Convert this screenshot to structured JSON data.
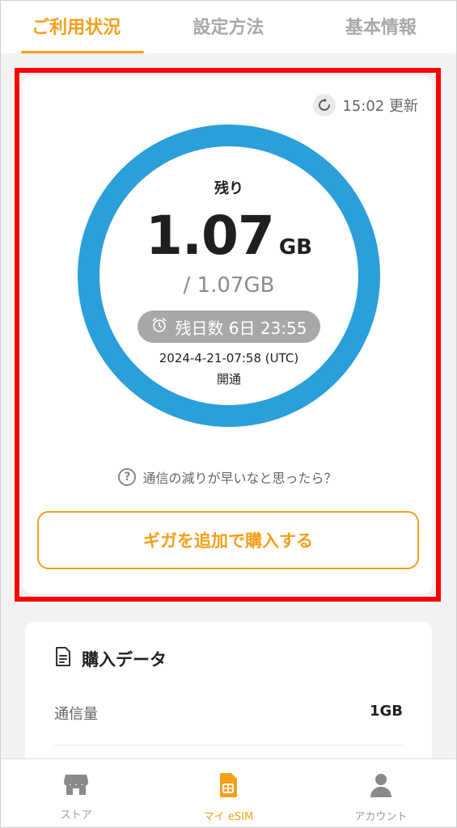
{
  "tabs": [
    {
      "label": "ご利用状況",
      "active": true
    },
    {
      "label": "設定方法",
      "active": false
    },
    {
      "label": "基本情報",
      "active": false
    }
  ],
  "usage": {
    "updated": "15:02 更新",
    "remaining_label": "残り",
    "remaining_value": "1.07",
    "remaining_unit": "GB",
    "total": "/ 1.07GB",
    "remaining_fraction": 1.0,
    "days_left": "残日数 6日 23:55",
    "opened_date": "2024-4-21-07:58 (UTC)",
    "opened_label": "開通",
    "help_text": "通信の減りが早いなと思ったら？",
    "buy_button": "ギガを追加で購入する"
  },
  "purchase": {
    "title": "購入データ",
    "rows": [
      {
        "label": "通信量",
        "value": "1GB"
      }
    ]
  },
  "bottom_nav": [
    {
      "label": "ストア",
      "icon": "store-icon",
      "active": false
    },
    {
      "label": "マイ eSIM",
      "icon": "sim-icon",
      "active": true
    },
    {
      "label": "アカウント",
      "icon": "person-icon",
      "active": false
    }
  ],
  "colors": {
    "accent": "#f5a01a",
    "ring": "#2b9fd9",
    "highlight": "#ff0000"
  }
}
